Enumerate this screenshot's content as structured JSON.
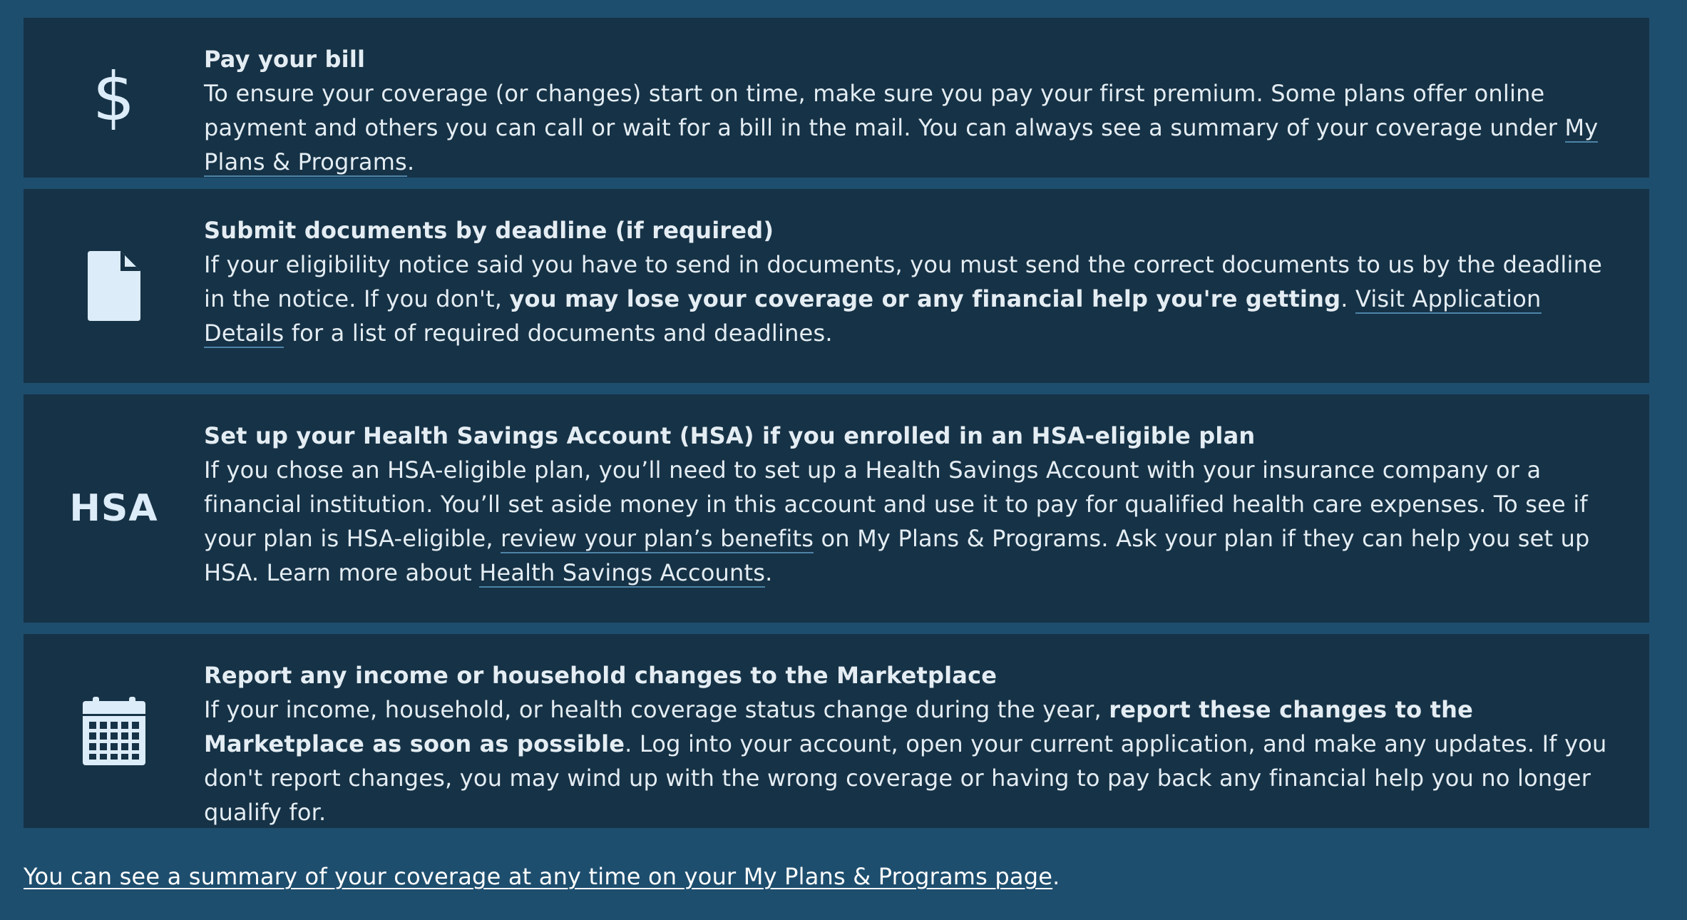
{
  "cards": [
    {
      "icon": "dollar-icon",
      "title": "Pay your bill",
      "text_1": "To ensure your coverage (or changes) start on time, make sure you pay your first premium. Some plans offer online payment and others you can call or wait for a bill in the mail. You can always see a summary of your coverage under ",
      "link_1": "My Plans & Programs",
      "text_2": "."
    },
    {
      "icon": "document-icon",
      "title": "Submit documents by deadline (if required)",
      "text_1": "If your eligibility notice said you have to send in documents, you must send the correct documents to us by the deadline in the notice. If you don't, ",
      "bold_1": "you may lose your coverage or any financial help you're getting",
      "text_2": ". ",
      "link_1": "Visit Application Details",
      "text_3": " for a list of required documents and deadlines."
    },
    {
      "icon": "hsa-icon",
      "icon_label": "HSA",
      "title": "Set up your Health Savings Account (HSA) if you enrolled in an HSA-eligible plan",
      "text_1": "If you chose an HSA-eligible plan, you’ll need to set up a Health Savings Account with your insurance company or a financial institution. You’ll set aside money in this account and use it to pay for qualified health care expenses. To see if your plan is HSA-eligible, ",
      "link_1": "review your plan’s benefits",
      "text_2": " on My Plans & Programs. Ask your plan if they can help you set up HSA. Learn more about ",
      "link_2": "Health Savings Accounts",
      "text_3": "."
    },
    {
      "icon": "calendar-icon",
      "title": "Report any income or household changes to the Marketplace",
      "text_1": "If your income, household, or health coverage status change during the year, ",
      "bold_1": "report these changes to the Marketplace as soon as possible",
      "text_2": ". Log into your account, open your current application, and make any updates. If you don't report changes, you may wind up with the wrong coverage or having to pay back any financial help you no longer qualify for."
    }
  ],
  "footer": {
    "link": "You can see a summary of your coverage at any time on your My Plans & Programs page",
    "suffix": "."
  },
  "colors": {
    "page_background": "#1e4e6e",
    "card_background": "#163246",
    "text": "#e4edf3",
    "link_underline": "#4d84a8"
  }
}
